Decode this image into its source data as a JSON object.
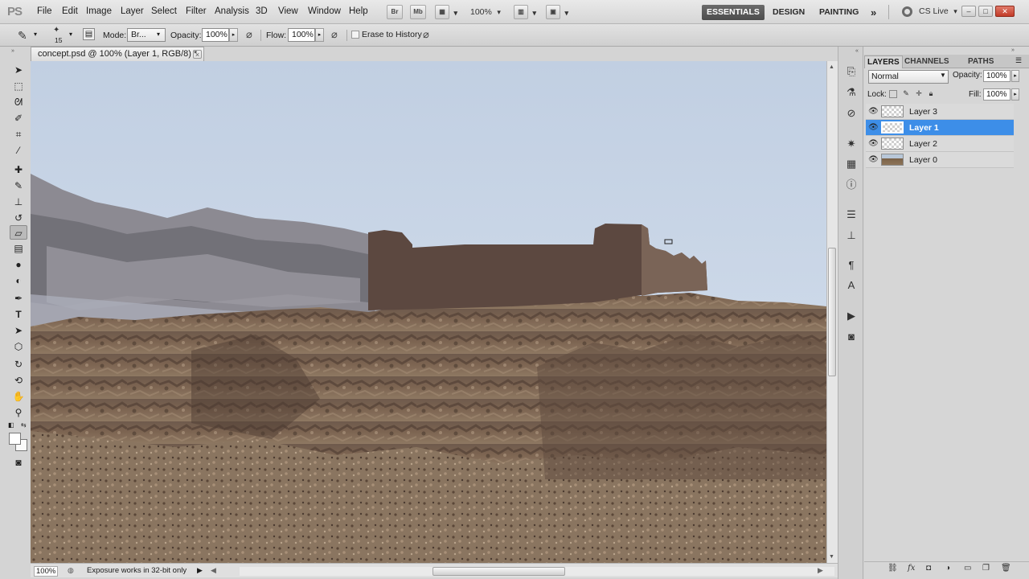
{
  "app": {
    "logo": "PS"
  },
  "menu": [
    "File",
    "Edit",
    "Image",
    "Layer",
    "Select",
    "Filter",
    "Analysis",
    "3D",
    "View",
    "Window",
    "Help"
  ],
  "appbar": {
    "bridge": "Br",
    "mini_bridge": "Mb",
    "zoom": "100%"
  },
  "workspaces": [
    "ESSENTIALS",
    "DESIGN",
    "PAINTING"
  ],
  "workspace_more": "»",
  "cs_live": "CS Live",
  "window_buttons": {
    "minimize": "–",
    "restore": "□",
    "close": "✕"
  },
  "options": {
    "brush_size": "15",
    "mode_label": "Mode:",
    "mode_value": "Br...",
    "opacity_label": "Opacity:",
    "opacity_value": "100%",
    "flow_label": "Flow:",
    "flow_value": "100%",
    "erase_history_label": "Erase to History"
  },
  "document": {
    "tab_title": "concept.psd @ 100% (Layer 1, RGB/8) *"
  },
  "status": {
    "zoom": "100%",
    "message": "Exposure works in 32-bit only"
  },
  "panel": {
    "tabs": [
      "LAYERS",
      "CHANNELS",
      "PATHS"
    ],
    "blend_mode": "Normal",
    "opacity_label": "Opacity:",
    "opacity_value": "100%",
    "lock_label": "Lock:",
    "fill_label": "Fill:",
    "fill_value": "100%"
  },
  "layers": [
    {
      "name": "Layer 3",
      "selected": false
    },
    {
      "name": "Layer 1",
      "selected": true
    },
    {
      "name": "Layer 2",
      "selected": false
    },
    {
      "name": "Layer 0",
      "selected": false
    }
  ],
  "colors": {
    "selection": "#3d8ee8",
    "sky": "#c4d2e6",
    "castle": "#5c4840",
    "rock": "#7d6552"
  }
}
